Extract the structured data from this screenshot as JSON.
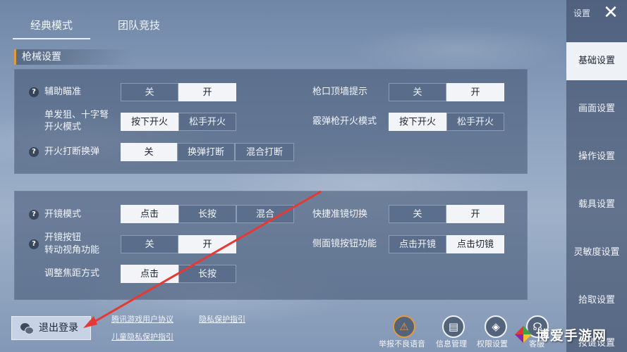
{
  "tabs": [
    "经典模式",
    "团队竞技"
  ],
  "section_title": "枪械设置",
  "panel1": {
    "aim_assist": {
      "label": "辅助瞄准",
      "options": [
        "关",
        "开"
      ],
      "selected": 1
    },
    "single_shot": {
      "label_line1": "单发狙、十字弩",
      "label_line2": "开火模式",
      "options": [
        "按下开火",
        "松手开火"
      ],
      "selected": 0
    },
    "fire_interrupt": {
      "label": "开火打断换弹",
      "options": [
        "关",
        "换弹打断",
        "混合打断"
      ],
      "selected": 0
    },
    "muzzle_wall": {
      "label": "枪口顶墙提示",
      "options": [
        "关",
        "开"
      ],
      "selected": 1
    },
    "shotgun_fire": {
      "label": "霰弹枪开火模式",
      "options": [
        "按下开火",
        "松手开火"
      ],
      "selected": 0
    }
  },
  "panel2": {
    "scope_mode": {
      "label": "开镜模式",
      "options": [
        "点击",
        "长按",
        "混合"
      ],
      "selected": 0
    },
    "scope_button": {
      "label_line1": "开镜按钮",
      "label_line2": "转动视角功能",
      "options": [
        "关",
        "开"
      ],
      "selected": 1
    },
    "zoom_mode": {
      "label": "调整焦距方式",
      "options": [
        "点击",
        "长按"
      ],
      "selected": 0
    },
    "quick_scope": {
      "label": "快捷准镜切换",
      "options": [
        "关",
        "开"
      ],
      "selected": 1
    },
    "side_scope": {
      "label": "侧面镜按钮功能",
      "options": [
        "点击开镜",
        "点击切镜"
      ],
      "selected": 1
    }
  },
  "sidebar": {
    "header": "设置",
    "items": [
      "基础设置",
      "画面设置",
      "操作设置",
      "载具设置",
      "灵敏度设置",
      "拾取设置",
      "按键设置"
    ],
    "active": 0
  },
  "bottom": {
    "logout": "退出登录",
    "links": [
      "腾讯游戏用户协议",
      "隐私保护指引",
      "儿童隐私保护指引"
    ],
    "icons": [
      {
        "label": "举报不良语音",
        "icon": "warning-icon"
      },
      {
        "label": "信息管理",
        "icon": "id-card-icon"
      },
      {
        "label": "权限设置",
        "icon": "shield-icon"
      },
      {
        "label": "客服",
        "icon": "headset-icon"
      }
    ]
  },
  "watermark": "博爱手游网",
  "colors": {
    "accent": "#e39a3c",
    "arrow": "#e53935"
  }
}
